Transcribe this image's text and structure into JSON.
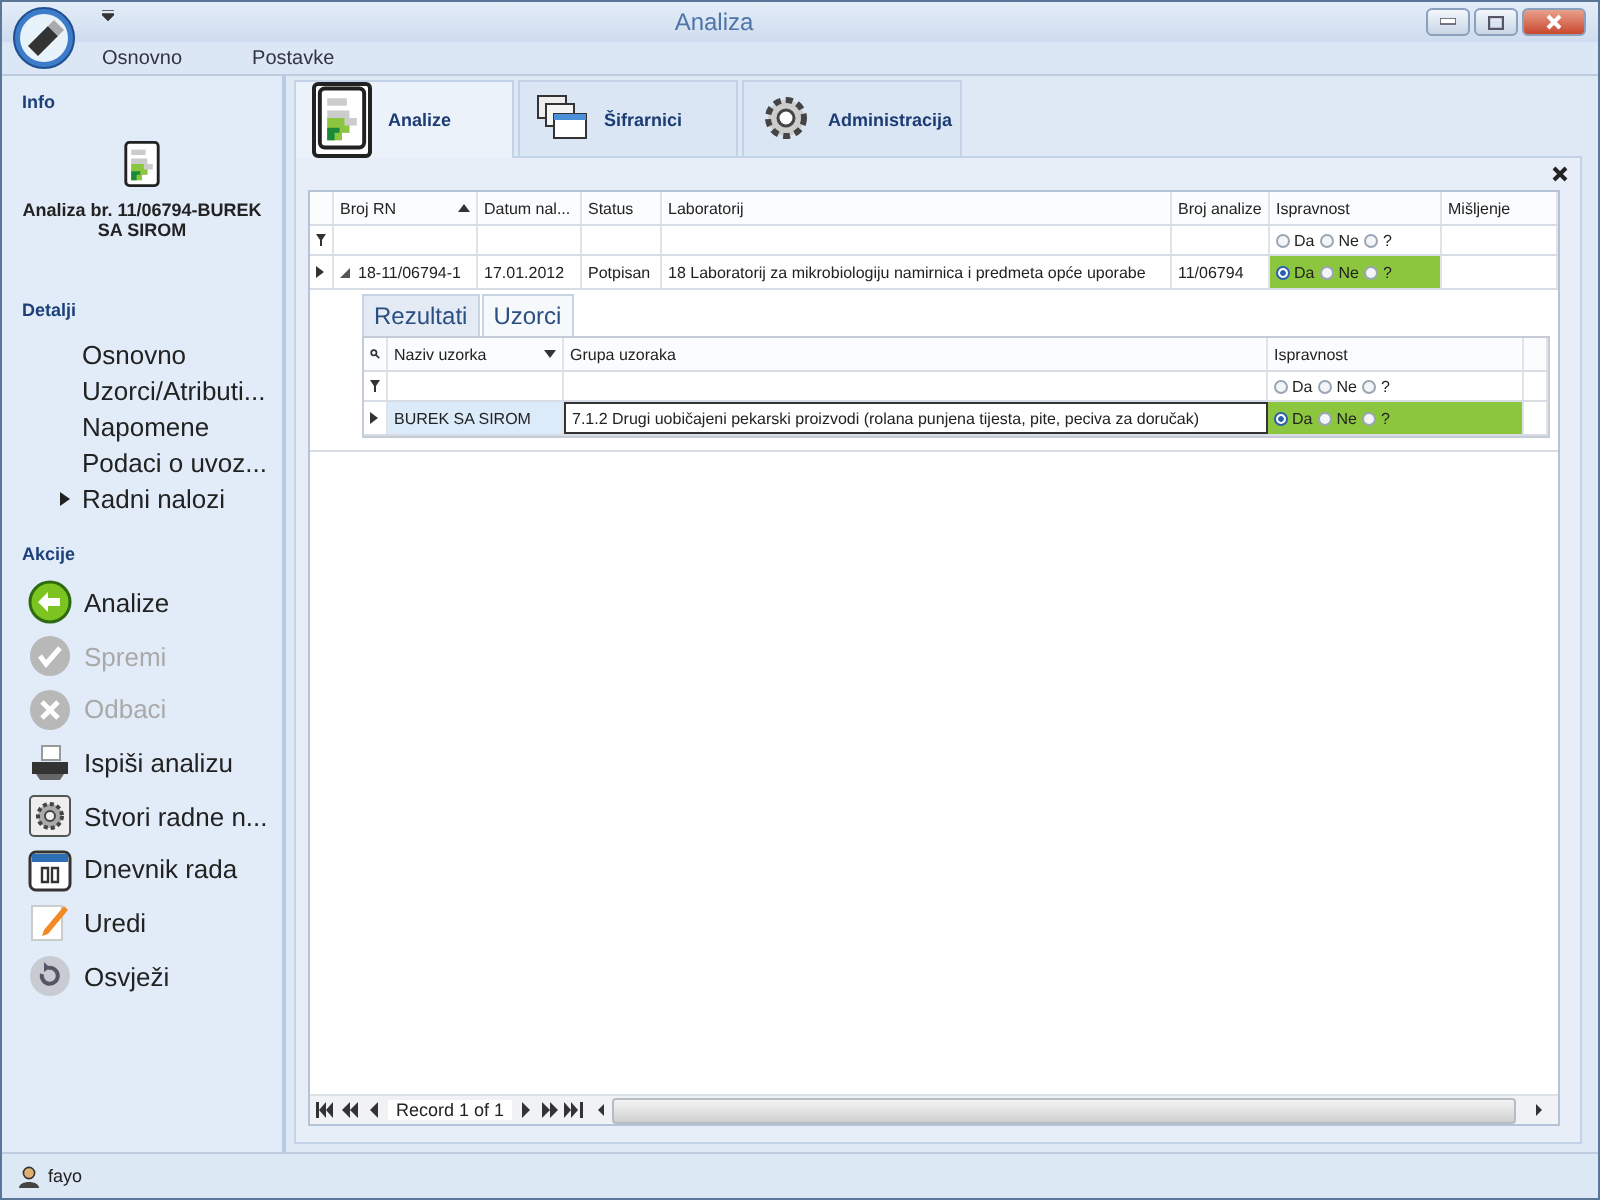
{
  "window": {
    "title": "Analiza"
  },
  "menu": [
    {
      "label": "Osnovno"
    },
    {
      "label": "Postavke"
    }
  ],
  "sidebar": {
    "info": {
      "heading": "Info",
      "title": "Analiza br. 11/06794-BUREK SA SIROM"
    },
    "details": {
      "heading": "Detalji",
      "items": [
        {
          "label": "Osnovno",
          "selected": false
        },
        {
          "label": "Uzorci/Atributi...",
          "selected": false
        },
        {
          "label": "Napomene",
          "selected": false
        },
        {
          "label": "Podaci o uvoz...",
          "selected": false
        },
        {
          "label": "Radni nalozi",
          "selected": true
        }
      ]
    },
    "actions": {
      "heading": "Akcije",
      "items": [
        {
          "label": "Analize",
          "disabled": false
        },
        {
          "label": "Spremi",
          "disabled": true
        },
        {
          "label": "Odbaci",
          "disabled": true
        },
        {
          "label": "Ispiši analizu",
          "disabled": false
        },
        {
          "label": "Stvori radne n...",
          "disabled": false
        },
        {
          "label": "Dnevnik rada",
          "disabled": false
        },
        {
          "label": "Uredi",
          "disabled": false
        },
        {
          "label": "Osvježi",
          "disabled": false
        }
      ]
    }
  },
  "tabs": [
    {
      "label": "Analize",
      "selected": true
    },
    {
      "label": "Šifrarnici",
      "selected": false
    },
    {
      "label": "Administracija",
      "selected": false
    }
  ],
  "grid": {
    "columns": [
      {
        "label": "Broj RN",
        "sort_ascending": true
      },
      {
        "label": "Datum nal..."
      },
      {
        "label": "Status"
      },
      {
        "label": "Laboratorij"
      },
      {
        "label": "Broj analize"
      },
      {
        "label": "Ispravnost"
      },
      {
        "label": "Mišljenje"
      }
    ],
    "filter_options": [
      {
        "label": "Da",
        "selected": false
      },
      {
        "label": "Ne",
        "selected": false
      },
      {
        "label": "?",
        "selected": false
      }
    ],
    "rows": [
      {
        "expanded": true,
        "cells": [
          "18-11/06794-1",
          "17.01.2012",
          "Potpisan",
          "18 Laboratorij za mikrobiologiju namirnica i predmeta opće uporabe",
          "11/06794"
        ],
        "ispravnost": {
          "highlighted": true,
          "options": [
            {
              "label": "Da",
              "selected": true
            },
            {
              "label": "Ne",
              "selected": false
            },
            {
              "label": "?",
              "selected": false
            }
          ]
        }
      }
    ]
  },
  "detail": {
    "tabs": [
      {
        "label": "Rezultati",
        "selected": false
      },
      {
        "label": "Uzorci",
        "selected": true
      }
    ],
    "grid": {
      "columns": [
        {
          "label": "Naziv uzorka",
          "sort_descending": true
        },
        {
          "label": "Grupa uzoraka"
        },
        {
          "label": "Ispravnost"
        }
      ],
      "filter_options": [
        {
          "label": "Da",
          "selected": false
        },
        {
          "label": "Ne",
          "selected": false
        },
        {
          "label": "?",
          "selected": false
        }
      ],
      "rows": [
        {
          "selected": true,
          "cells": [
            "BUREK SA SIROM",
            "7.1.2 Drugi uobičajeni pekarski proizvodi (rolana punjena tijesta, pite, peciva za doručak)"
          ],
          "ispravnost": {
            "highlighted": true,
            "options": [
              {
                "label": "Da",
                "selected": true
              },
              {
                "label": "Ne",
                "selected": false
              },
              {
                "label": "?",
                "selected": false
              }
            ]
          }
        }
      ]
    }
  },
  "pager": {
    "text": "Record 1 of 1"
  },
  "status_bar": {
    "user": "fayo"
  }
}
